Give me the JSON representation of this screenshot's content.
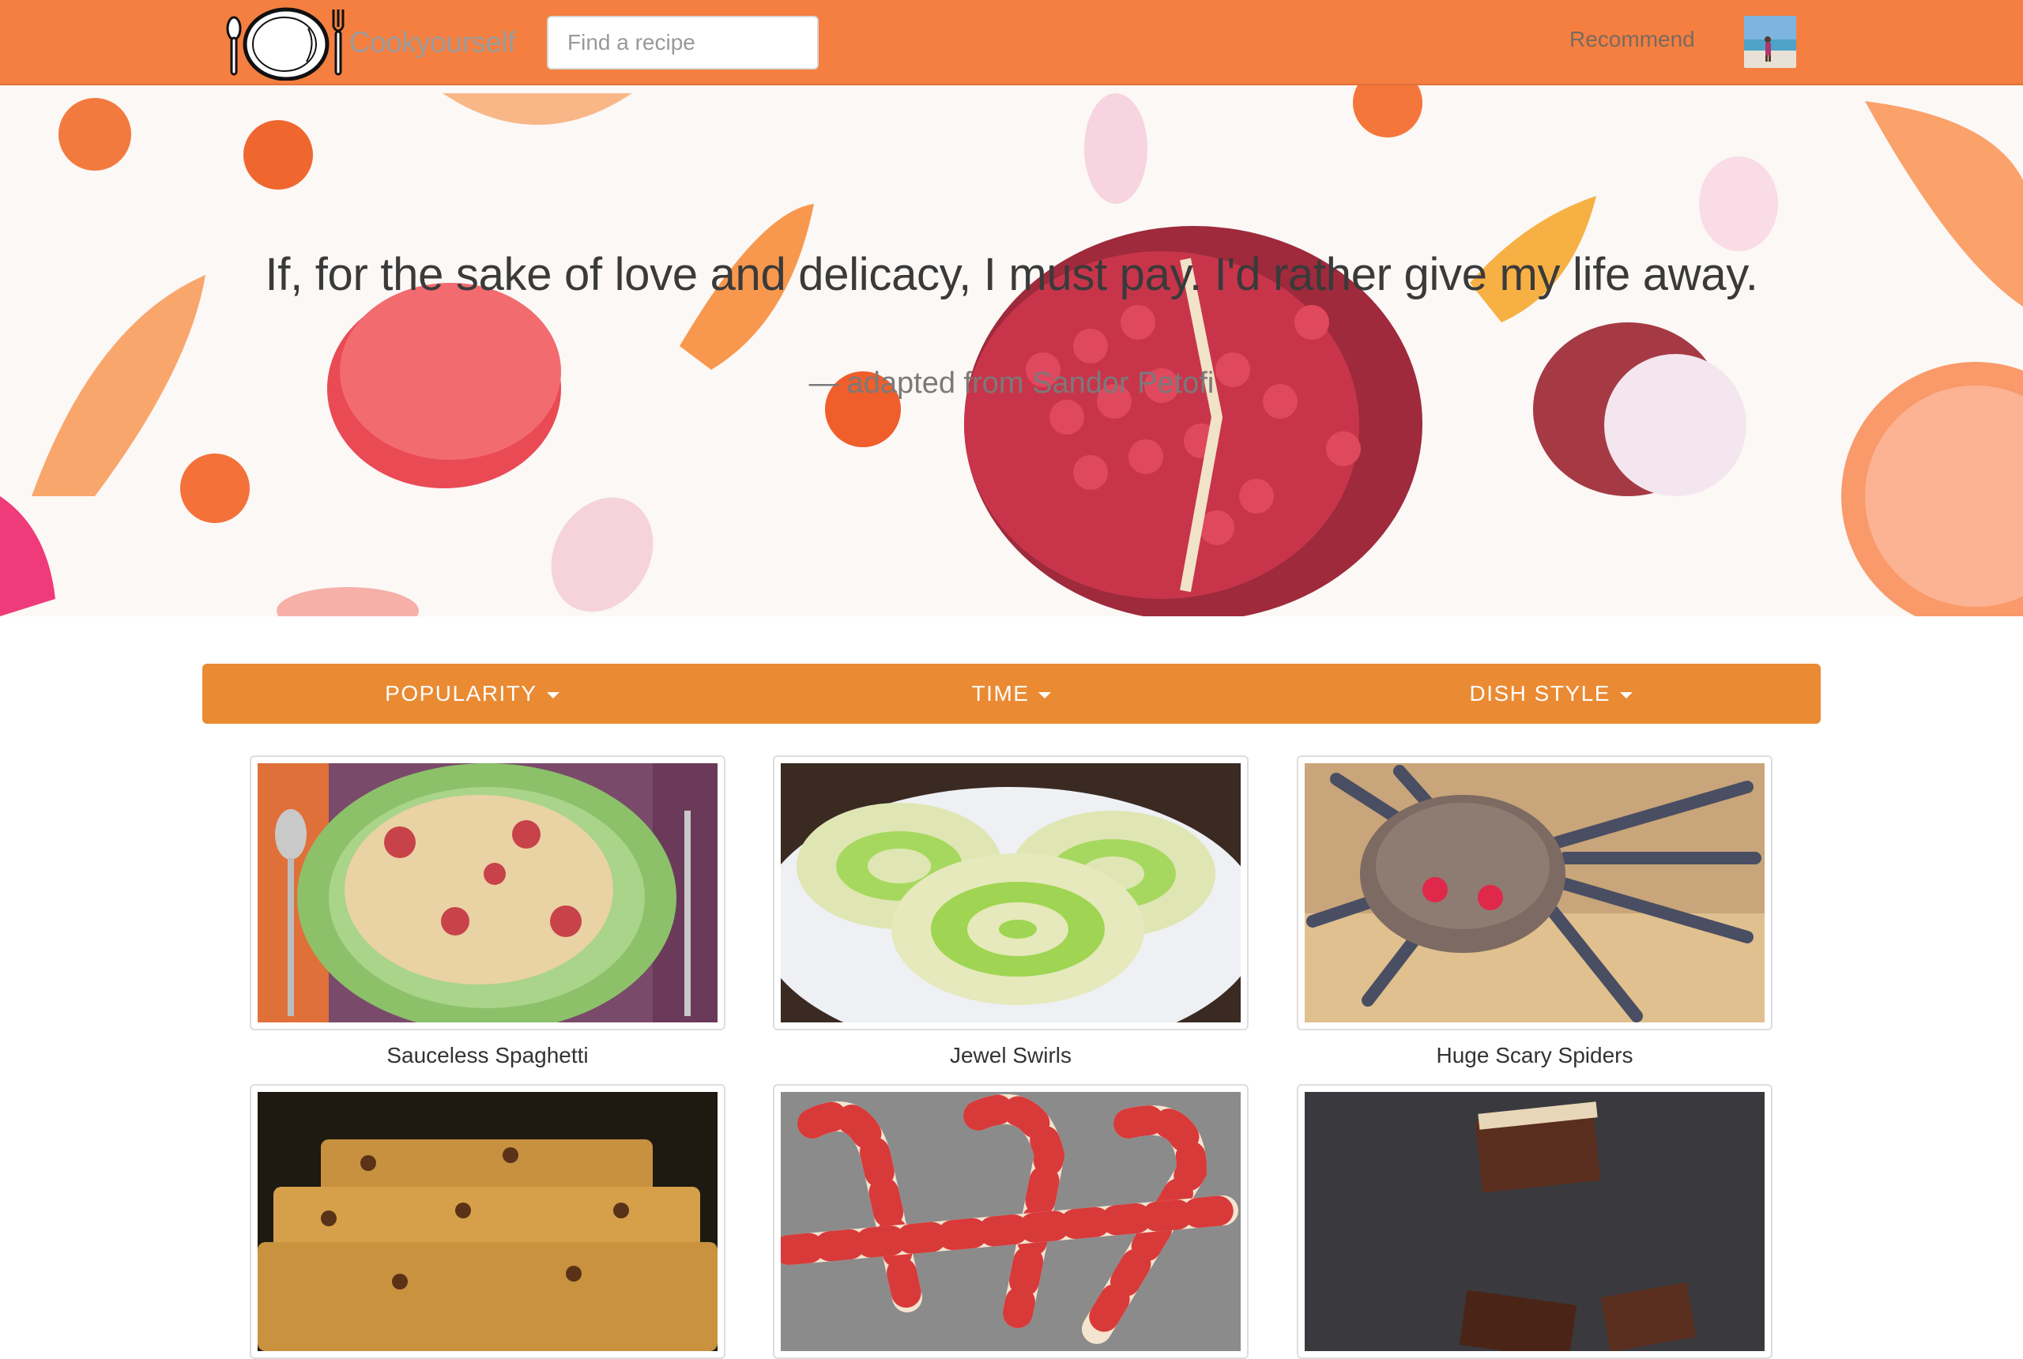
{
  "navbar": {
    "brand": "Cookyourself",
    "search_placeholder": "Find a recipe",
    "recommend_label": "Recommend",
    "accent_color": "#f47f40"
  },
  "hero": {
    "quote": "If, for the sake of love and delicacy, I must pay. I'd rather give my life away.",
    "attribution_dash": "—",
    "attribution": "adapted from Sandor Petofi"
  },
  "filters": [
    {
      "label": "POPULARITY"
    },
    {
      "label": "TIME"
    },
    {
      "label": "DISH STYLE"
    }
  ],
  "filter_bar_color": "#ea8a33",
  "recipes": [
    {
      "title": "Sauceless Spaghetti",
      "image": "spaghetti-plate"
    },
    {
      "title": "Jewel Swirls",
      "image": "green-swirl-cookies"
    },
    {
      "title": "Huge Scary Spiders",
      "image": "spider-cookie"
    },
    {
      "title": "",
      "image": "chocolate-chip-bars"
    },
    {
      "title": "",
      "image": "candy-cane-cookies"
    },
    {
      "title": "",
      "image": "chocolate-slices"
    }
  ],
  "icons": {
    "logo": "plate-fork-spoon-icon",
    "caret": "caret-down-icon"
  }
}
